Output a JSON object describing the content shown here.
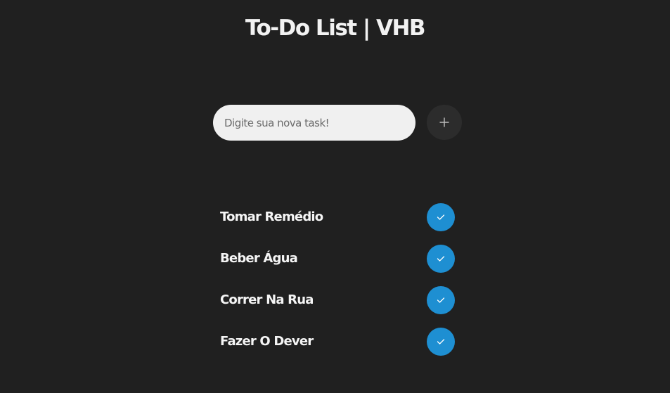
{
  "app": {
    "title": "To-Do List | VHB"
  },
  "new_task": {
    "placeholder": "Digite sua nova task!",
    "add_icon": "plus-icon"
  },
  "tasks": [
    {
      "label": "Tomar Remédio",
      "action_icon": "check-icon"
    },
    {
      "label": "Beber Água",
      "action_icon": "check-icon"
    },
    {
      "label": "Correr Na Rua",
      "action_icon": "check-icon"
    },
    {
      "label": "Fazer O Dever",
      "action_icon": "check-icon"
    }
  ],
  "colors": {
    "background": "#202020",
    "input_background": "#f0f0f0",
    "add_button": "#2c2c2c",
    "done_button": "#1e8fd2"
  }
}
